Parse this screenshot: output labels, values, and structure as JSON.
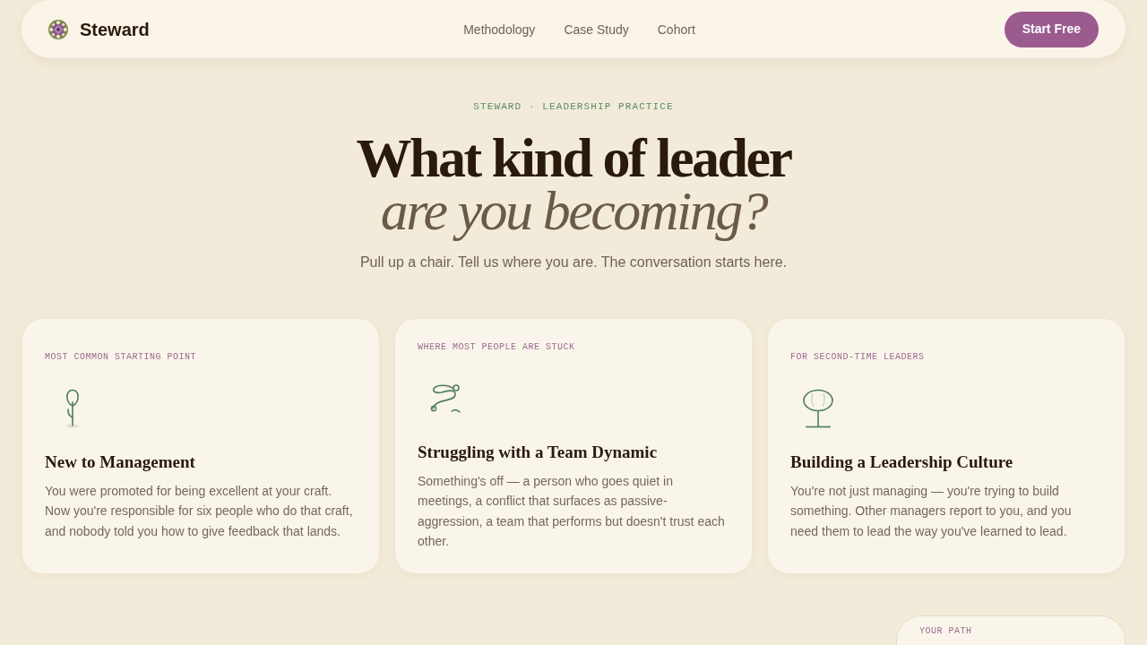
{
  "nav": {
    "brand": "Steward",
    "links": [
      {
        "label": "Methodology"
      },
      {
        "label": "Case Study"
      },
      {
        "label": "Cohort"
      }
    ],
    "cta": "Start Free"
  },
  "hero": {
    "eyebrow": "STEWARD · LEADERSHIP PRACTICE",
    "title_line_1": "What kind of leader",
    "title_line_2": "are you becoming?",
    "subtitle": "Pull up a chair. Tell us where you are. The conversation starts here."
  },
  "cards": [
    {
      "kind": "sapling",
      "label": "MOST COMMON STARTING POINT",
      "title": "New to Management",
      "body": "You were promoted for being excellent at your craft. Now you're responsible for six people who do that craft, and nobody told you how to give feedback that lands."
    },
    {
      "kind": "squiggle",
      "label": "WHERE MOST PEOPLE ARE STUCK",
      "title": "Struggling with a Team Dynamic",
      "body": "Something's off — a person who goes quiet in meetings, a conflict that surfaces as passive-aggression, a team that performs but doesn't trust each other."
    },
    {
      "kind": "tree",
      "label": "FOR SECOND-TIME LEADERS",
      "title": "Building a Leadership Culture",
      "body": "You're not just managing — you're trying to build something. Other managers report to you, and you need them to lead the way you've learned to lead."
    }
  ],
  "next_card": {
    "label": "YOUR PATH"
  }
}
